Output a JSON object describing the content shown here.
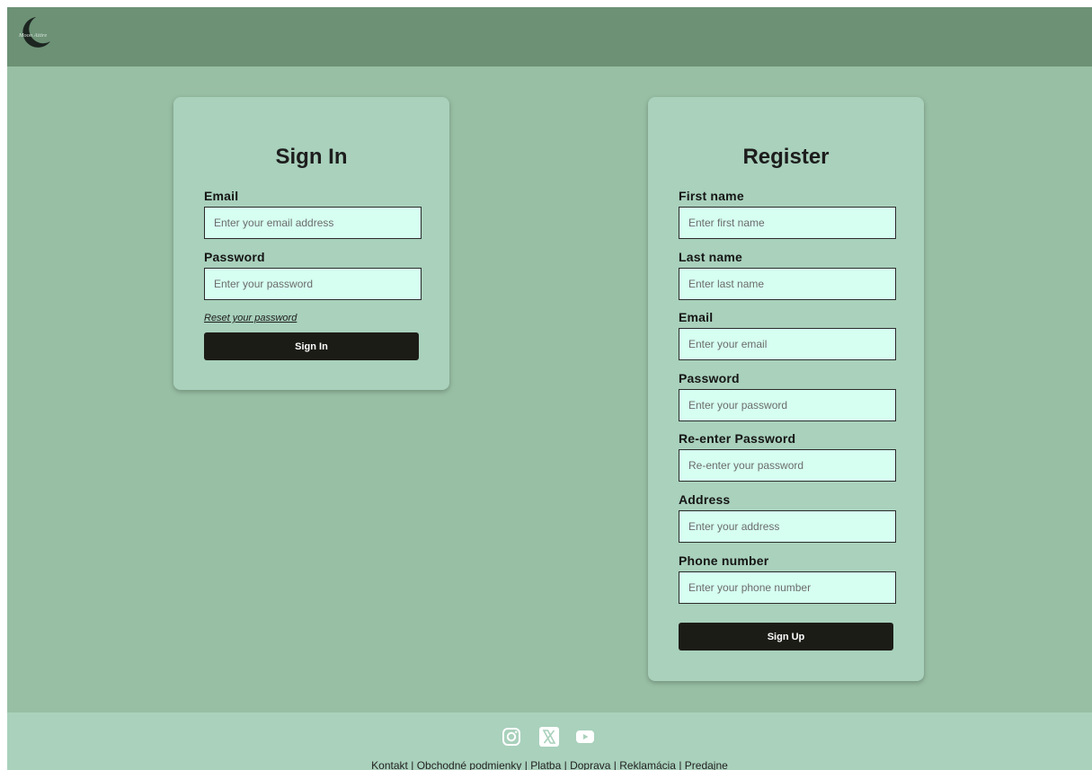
{
  "header": {
    "logo_text": "Moon Attire"
  },
  "signin": {
    "title": "Sign In",
    "email_label": "Email",
    "email_placeholder": "Enter your email address",
    "password_label": "Password",
    "password_placeholder": "Enter your password",
    "reset_link": "Reset your password",
    "submit_label": "Sign In"
  },
  "register": {
    "title": "Register",
    "fields": [
      {
        "label": "First name",
        "placeholder": "Enter first name"
      },
      {
        "label": "Last name",
        "placeholder": "Enter last name"
      },
      {
        "label": "Email",
        "placeholder": "Enter your email"
      },
      {
        "label": "Password",
        "placeholder": "Enter your password"
      },
      {
        "label": "Re-enter Password",
        "placeholder": "Re-enter your password"
      },
      {
        "label": "Address",
        "placeholder": "Enter your address"
      },
      {
        "label": "Phone number",
        "placeholder": "Enter your phone number"
      }
    ],
    "submit_label": "Sign Up"
  },
  "footer": {
    "social_icons": [
      "instagram-icon",
      "x-icon",
      "youtube-icon"
    ],
    "links": [
      "Kontakt",
      "Obchodné podmienky",
      "Platba",
      "Doprava",
      "Reklamácia",
      "Predajne"
    ],
    "separator": "|"
  },
  "colors": {
    "page_background": "#98bfa4",
    "header_background": "#6c9175",
    "card_background": "#a9d1bc",
    "input_background": "#d6fff1",
    "button_background": "#1c1c17"
  }
}
